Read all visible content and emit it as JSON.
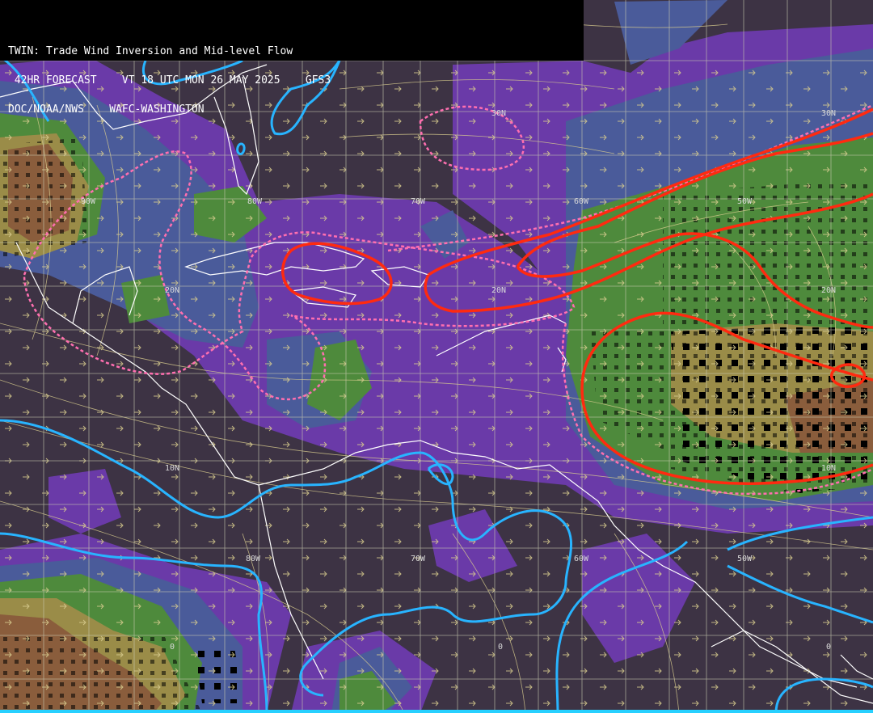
{
  "header": {
    "line1": "TWIN: Trade Wind Inversion and Mid-level Flow",
    "line2": " 42HR FORECAST    VT 18 UTC MON 26 MAY 2025    GFS3",
    "line3": "DOC/NOAA/NWS    WAFC-WASHINGTON"
  },
  "latitude_labels": [
    "30N",
    "30N",
    "20N",
    "20N",
    "20N",
    "10N",
    "10N",
    "0",
    "0",
    "0"
  ],
  "longitude_labels": [
    "90W",
    "80W",
    "70W",
    "60W",
    "50W",
    "80W",
    "70W",
    "60W",
    "50W"
  ],
  "colors": {
    "background": "#3d3344",
    "purple": "#6a3aa8",
    "blue": "#4a5b9a",
    "green": "#4e8a3c",
    "olive": "#9a8c48",
    "brown": "#8a5d3c",
    "streamline": "#d8cc8e",
    "grid": "#c9c9b0",
    "coast": "#ffffff",
    "zero_line": "#28b4ff",
    "inversion_contour": "#ff2a10",
    "dashed_contour": "#ff6fb0"
  }
}
